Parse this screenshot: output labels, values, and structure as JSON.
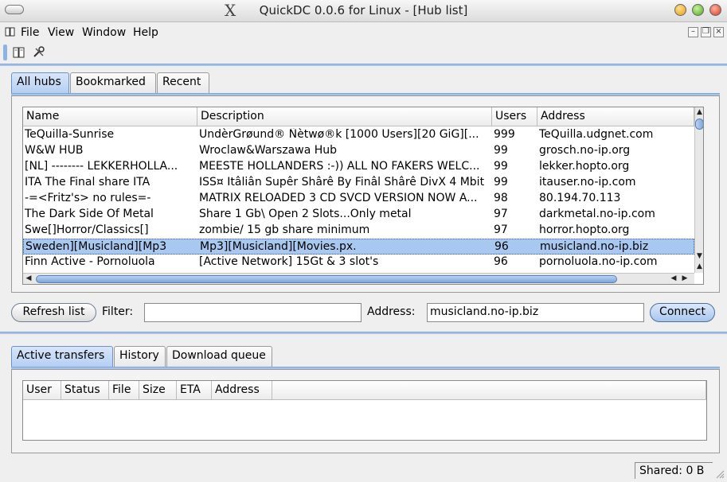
{
  "window": {
    "title": "QuickDC 0.0.6 for Linux - [Hub list]",
    "x_logo": "X"
  },
  "menu": {
    "items": [
      "File",
      "View",
      "Window",
      "Help"
    ],
    "mdi_buttons": [
      "–",
      "❐",
      "×"
    ]
  },
  "hub_tabs": [
    "All hubs",
    "Bookmarked",
    "Recent"
  ],
  "hub_table": {
    "columns": [
      "Name",
      "Description",
      "Users",
      "Address"
    ],
    "rows": [
      {
        "name": "TeQuilla-Sunrise",
        "description": "ÜndèrGrøund® Ñètwø®k [1000 Users][20 GiG][...",
        "users": "999",
        "address": "TeQuilla.udgnet.com"
      },
      {
        "name": "W&W HUB",
        "description": "Wroclaw&Warszawa Hub",
        "users": "99",
        "address": "grosch.no-ip.org"
      },
      {
        "name": "[NL] -------- LEKKERHOLLA...",
        "description": "MEESTE HOLLANDERS :-)) ALL NO FAKERS WELC...",
        "users": "99",
        "address": "lekker.hopto.org"
      },
      {
        "name": "ITA The Final share ITA",
        "description": "ISS¤ Itâliân Supêr Shârê By Finâl Shârê DivX 4 Mbit",
        "users": "99",
        "address": "itauser.no-ip.com"
      },
      {
        "name": "-=<Fritz's> no rules=-",
        "description": "MATRIX RELOADED 3 CD SVCD VERSION NOW A...",
        "users": "98",
        "address": "80.194.70.113"
      },
      {
        "name": "The Dark Side Of Metal",
        "description": "Share 1 Gb\\ Open 2 Slots...Only metal",
        "users": "97",
        "address": "darkmetal.no-ip.com"
      },
      {
        "name": "Swe[]Horror/Classics[]",
        "description": "zombie/ 15 gb share minimum",
        "users": "97",
        "address": "horror.hopto.org"
      },
      {
        "name": "Sweden][Musicland][Mp3",
        "description": "Mp3][Musicland][Movies.px.",
        "users": "96",
        "address": "musicland.no-ip.biz"
      },
      {
        "name": "Finn Active - Pornoluola",
        "description": "[Active Network] 15Gt & 3 slot's",
        "users": "96",
        "address": "pornoluola.no-ip.com"
      }
    ],
    "selected_index": 7
  },
  "controls": {
    "refresh_label": "Refresh list",
    "filter_label": "Filter:",
    "filter_value": "",
    "address_label": "Address:",
    "address_value": "musicland.no-ip.biz",
    "connect_label": "Connect"
  },
  "transfer_tabs": [
    "Active transfers",
    "History",
    "Download queue"
  ],
  "transfer_table": {
    "columns": [
      "User",
      "Status",
      "File",
      "Size",
      "ETA",
      "Address"
    ]
  },
  "status": {
    "shared": "Shared: 0 B"
  },
  "colors": {
    "selection": "#a9c8ef",
    "accent": "#7fa5d6"
  }
}
